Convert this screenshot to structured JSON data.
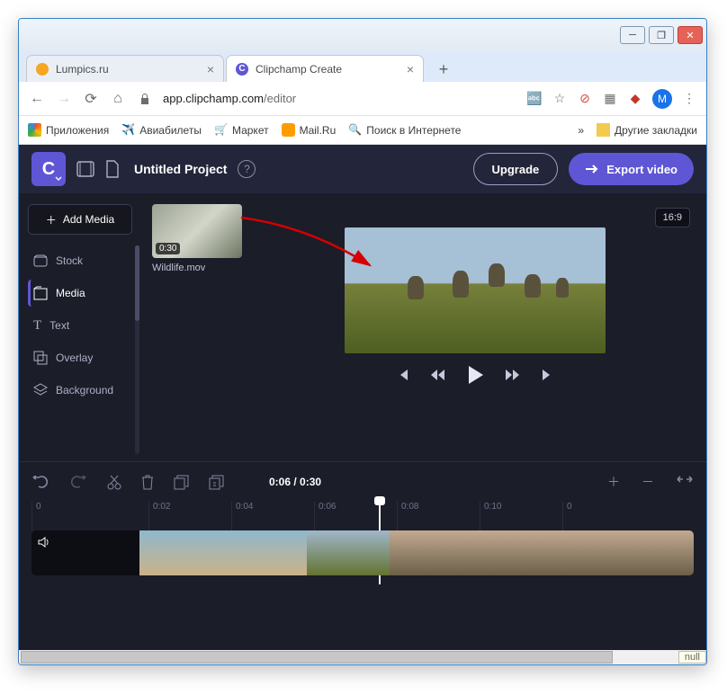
{
  "window": {
    "tabs": [
      {
        "title": "Lumpics.ru"
      },
      {
        "title": "Clipchamp Create",
        "favicon_letter": "C"
      }
    ],
    "url_host": "app.clipchamp.com",
    "url_path": "/editor",
    "account_initial": "M"
  },
  "bookmarks": [
    {
      "label": "Приложения"
    },
    {
      "label": "Авиабилеты"
    },
    {
      "label": "Маркет"
    },
    {
      "label": "Mail.Ru"
    },
    {
      "label": "Поиск в Интернете"
    }
  ],
  "bookmarks_overflow": "»",
  "bookmarks_other": "Другие закладки",
  "appbar": {
    "logo_letter": "C",
    "project_title": "Untitled Project",
    "upgrade": "Upgrade",
    "export": "Export video"
  },
  "sidebar": {
    "add_media": "Add Media",
    "items": [
      {
        "label": "Stock"
      },
      {
        "label": "Media"
      },
      {
        "label": "Text"
      },
      {
        "label": "Overlay"
      },
      {
        "label": "Background"
      }
    ],
    "active_index": 1
  },
  "library": {
    "clips": [
      {
        "name": "Wildlife.mov",
        "duration": "0:30"
      }
    ]
  },
  "preview": {
    "aspect_ratio": "16:9"
  },
  "timeline": {
    "current": "0:06",
    "total": "0:30",
    "time_display": "0:06 / 0:30",
    "ticks": [
      "0",
      "0:02",
      "0:04",
      "0:06",
      "0:08",
      "0:10",
      "0"
    ]
  },
  "footer": {
    "null_text": "null"
  }
}
